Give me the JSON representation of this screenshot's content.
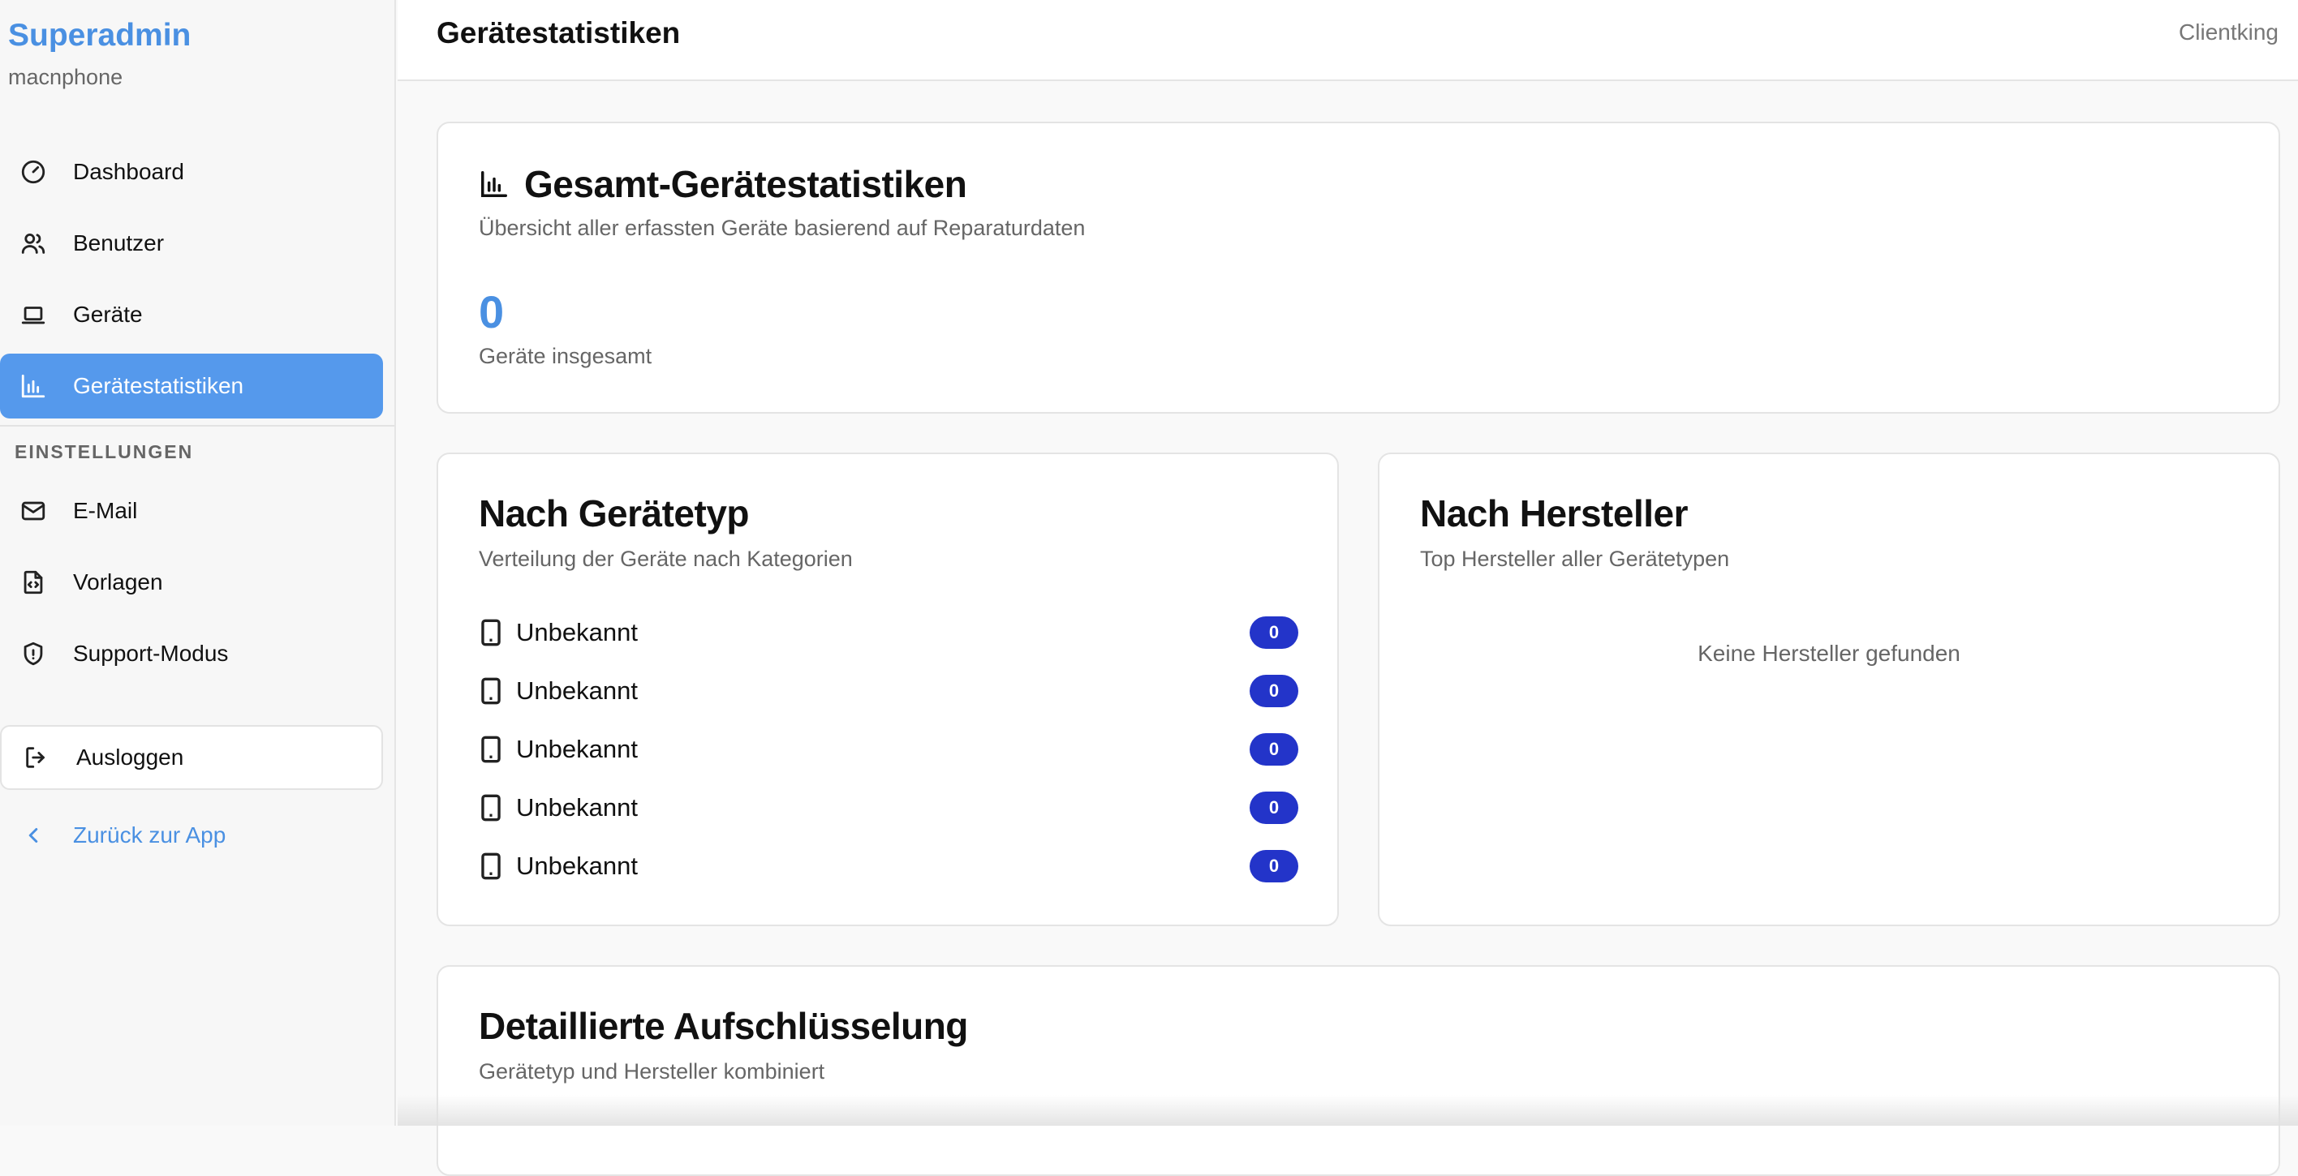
{
  "sidebar": {
    "brand_title": "Superadmin",
    "brand_subtitle": "macnphone",
    "items": [
      {
        "label": "Dashboard",
        "icon": "gauge-icon"
      },
      {
        "label": "Benutzer",
        "icon": "users-icon"
      },
      {
        "label": "Geräte",
        "icon": "laptop-icon"
      },
      {
        "label": "Gerätestatistiken",
        "icon": "bar-chart-icon",
        "active": true
      }
    ],
    "section_label": "EINSTELLUNGEN",
    "settings_items": [
      {
        "label": "E-Mail",
        "icon": "mail-icon"
      },
      {
        "label": "Vorlagen",
        "icon": "file-code-icon"
      },
      {
        "label": "Support-Modus",
        "icon": "shield-icon"
      }
    ],
    "logout_label": "Ausloggen",
    "back_label": "Zurück zur App"
  },
  "header": {
    "title": "Gerätestatistiken",
    "right_text": "Clientking"
  },
  "total_card": {
    "title": "Gesamt-Gerätestatistiken",
    "description": "Übersicht aller erfassten Geräte basierend auf Reparaturdaten",
    "value": "0",
    "value_label": "Geräte insgesamt"
  },
  "type_card": {
    "title": "Nach Gerätetyp",
    "description": "Verteilung der Geräte nach Kategorien",
    "rows": [
      {
        "label": "Unbekannt",
        "count": "0"
      },
      {
        "label": "Unbekannt",
        "count": "0"
      },
      {
        "label": "Unbekannt",
        "count": "0"
      },
      {
        "label": "Unbekannt",
        "count": "0"
      },
      {
        "label": "Unbekannt",
        "count": "0"
      }
    ]
  },
  "maker_card": {
    "title": "Nach Hersteller",
    "description": "Top Hersteller aller Gerätetypen",
    "empty_text": "Keine Hersteller gefunden"
  },
  "detail_card": {
    "title": "Detaillierte Aufschlüsselung",
    "description": "Gerätetyp und Hersteller kombiniert"
  },
  "colors": {
    "accent": "#4a90e2",
    "active_nav": "#5599ec",
    "badge": "#2334c9"
  }
}
